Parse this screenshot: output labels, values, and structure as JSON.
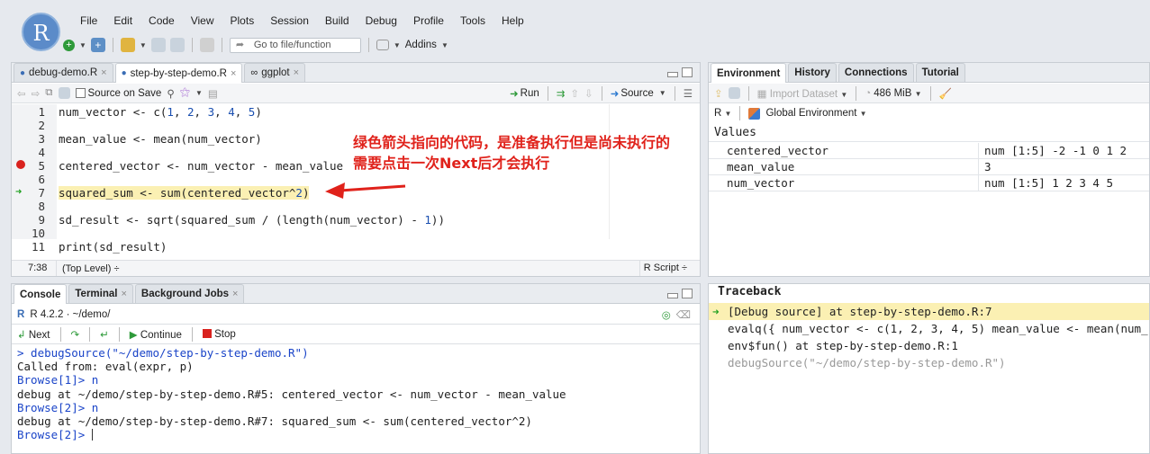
{
  "app": {
    "logo_letter": "R"
  },
  "menu": [
    "File",
    "Edit",
    "Code",
    "View",
    "Plots",
    "Session",
    "Build",
    "Debug",
    "Profile",
    "Tools",
    "Help"
  ],
  "toolbar": {
    "goto_placeholder": "Go to file/function",
    "addins_label": "Addins"
  },
  "editor": {
    "tabs": [
      {
        "label": "debug-demo.R"
      },
      {
        "label": "step-by-step-demo.R"
      },
      {
        "label": "ggplot"
      }
    ],
    "source_on_save": "Source on Save",
    "run_label": "Run",
    "source_label": "Source",
    "lines": [
      {
        "n": "1",
        "html": "num_vector <- c(<span class='num'>1</span>, <span class='num'>2</span>, <span class='num'>3</span>, <span class='num'>4</span>, <span class='num'>5</span>)"
      },
      {
        "n": "2",
        "html": ""
      },
      {
        "n": "3",
        "html": "mean_value <- mean(num_vector)"
      },
      {
        "n": "4",
        "html": ""
      },
      {
        "n": "5",
        "html": "centered_vector <- num_vector - mean_value"
      },
      {
        "n": "6",
        "html": ""
      },
      {
        "n": "7",
        "html": "squared_sum <- sum(centered_vector^<span class='num'>2</span>)"
      },
      {
        "n": "8",
        "html": ""
      },
      {
        "n": "9",
        "html": "sd_result <- sqrt(squared_sum / (length(num_vector) - <span class='num'>1</span>))"
      },
      {
        "n": "10",
        "html": ""
      },
      {
        "n": "11",
        "html": "print(sd_result)"
      }
    ],
    "status_pos": "7:38",
    "status_scope": "(Top Level) ÷",
    "status_type": "R Script ÷"
  },
  "annotation": {
    "line1": "绿色箭头指向的代码，是准备执行但是尚未执行的",
    "line2": "需要点击一次Next后才会执行"
  },
  "console": {
    "tabs": [
      {
        "label": "Console"
      },
      {
        "label": "Terminal"
      },
      {
        "label": "Background Jobs"
      }
    ],
    "version": "R 4.2.2 · ~/demo/",
    "next_label": "Next",
    "continue_label": "Continue",
    "stop_label": "Stop",
    "output": [
      {
        "cls": "blue",
        "text": "> debugSource(\"~/demo/step-by-step-demo.R\")"
      },
      {
        "cls": "",
        "text": "Called from: eval(expr, p)"
      },
      {
        "cls": "blue",
        "text": "Browse[1]> n"
      },
      {
        "cls": "",
        "text": "debug at ~/demo/step-by-step-demo.R#5: centered_vector <- num_vector - mean_value"
      },
      {
        "cls": "blue",
        "text": "Browse[2]> n"
      },
      {
        "cls": "",
        "text": "debug at ~/demo/step-by-step-demo.R#7: squared_sum <- sum(centered_vector^2)"
      },
      {
        "cls": "blue",
        "text": "Browse[2]> "
      }
    ]
  },
  "env": {
    "tabs": [
      {
        "label": "Environment"
      },
      {
        "label": "History"
      },
      {
        "label": "Connections"
      },
      {
        "label": "Tutorial"
      }
    ],
    "import_label": "Import Dataset",
    "memory": "486 MiB",
    "lang": "R",
    "scope": "Global Environment",
    "section": "Values",
    "rows": [
      {
        "name": "centered_vector",
        "value": "num [1:5] -2 -1 0 1 2"
      },
      {
        "name": "mean_value",
        "value": "3"
      },
      {
        "name": "num_vector",
        "value": "num [1:5] 1 2 3 4 5"
      }
    ]
  },
  "traceback": {
    "title": "Traceback",
    "lines": [
      "[Debug source] at step-by-step-demo.R:7",
      "evalq({ num_vector <- c(1, 2, 3, 4, 5) mean_value <- mean(num_",
      "env$fun() at step-by-step-demo.R:1",
      "debugSource(\"~/demo/step-by-step-demo.R\")"
    ]
  }
}
